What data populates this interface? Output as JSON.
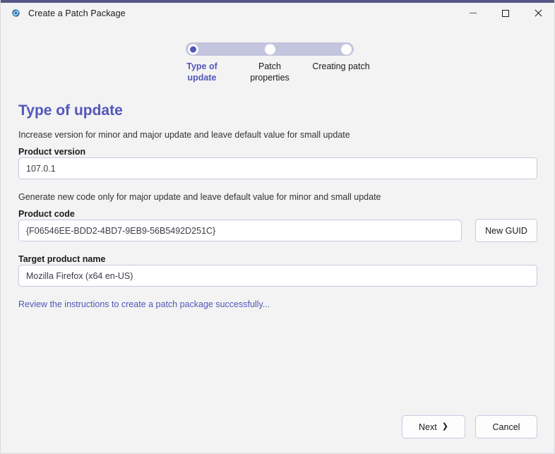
{
  "window": {
    "title": "Create a Patch Package",
    "app_icon": "patch-package-icon",
    "accent_color": "#575787",
    "controls": {
      "minimize": "minimize-icon",
      "maximize": "maximize-icon",
      "close": "close-icon"
    }
  },
  "stepper": {
    "active_index": 0,
    "steps": [
      {
        "label": "Type of\nupdate",
        "line1": "Type of",
        "line2": "update",
        "state": "active"
      },
      {
        "label": "Patch\nproperties",
        "line1": "Patch",
        "line2": "properties",
        "state": "inactive"
      },
      {
        "label": "Creating patch",
        "line1": "Creating patch",
        "line2": "",
        "state": "inactive"
      }
    ],
    "track_color": "#c3c5de",
    "active_color": "#5257ba"
  },
  "page": {
    "title": "Type of update",
    "title_color": "#5257ba",
    "helper_version": "Increase version for minor and major update and leave default value for small update",
    "helper_code": "Generate new code only for major update and leave default value for minor and small update"
  },
  "fields": {
    "product_version": {
      "label": "Product version",
      "value": "107.0.1",
      "placeholder": "107.0.1"
    },
    "product_code": {
      "label": "Product code",
      "value": "{F06546EE-BDD2-4BD7-9EB9-56B5492D251C}",
      "placeholder": "{F06546EE-BDD2-4BD7-9EB9-56B5492D251C}"
    },
    "target_product_name": {
      "label": "Target product name",
      "value": "Mozilla Firefox (x64 en-US)",
      "placeholder": "Mozilla Firefox (x64 en-US)"
    }
  },
  "buttons": {
    "new_guid": "New GUID",
    "next": "Next",
    "next_icon": "chevron-right-icon",
    "cancel": "Cancel"
  },
  "link": {
    "text": "Review the instructions to create a patch package successfully...",
    "color": "#5257ba"
  }
}
